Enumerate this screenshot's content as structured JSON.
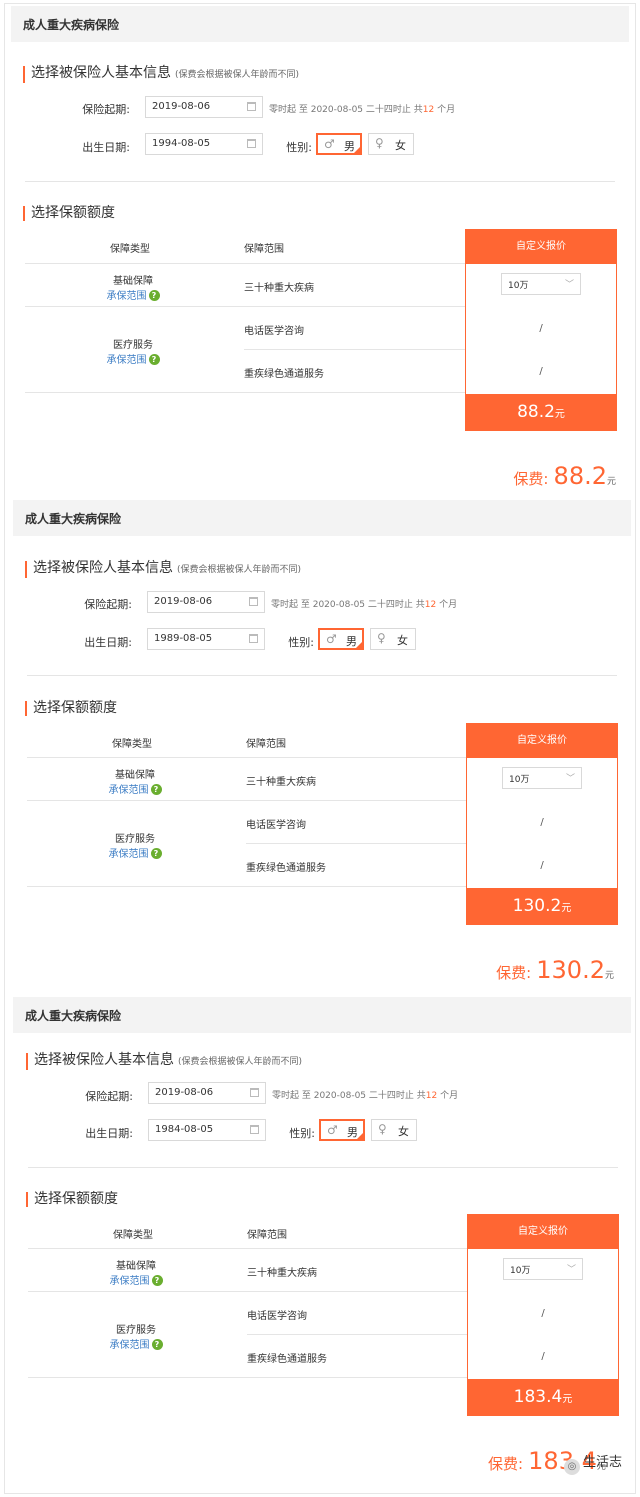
{
  "panels": [
    {
      "title": "成人重大疾病保险",
      "basic": {
        "title": "选择被保险人基本信息",
        "note": "(保费会根据被保人年龄而不同)"
      },
      "start": {
        "label": "保险起期:",
        "value": "2019-08-06"
      },
      "period": {
        "pre": "零时起 至 2020-08-05 二十四时止 共",
        "months": "12",
        "post": " 个月"
      },
      "birth": {
        "label": "出生日期:",
        "value": "1994-08-05"
      },
      "gender": {
        "label": "性别:",
        "male": "男",
        "female": "女",
        "selected": "male"
      },
      "coverage": {
        "title": "选择保额额度"
      },
      "table": {
        "col_type": "保障类型",
        "col_range": "保障范围",
        "col_custom": "自定义报价",
        "basic_type": "基础保障",
        "basic_link": "承保范围",
        "basic_range": "三十种重大疾病",
        "basic_amount": "10万",
        "medical_type": "医疗服务",
        "medical_link": "承保范围",
        "medical_range_1": "电话医学咨询",
        "medical_range_2": "重疾绿色通道服务",
        "slash": "/",
        "price": "88.2",
        "unit": "元"
      },
      "total": {
        "label": "保费:",
        "value": "88.2",
        "unit": "元"
      }
    },
    {
      "title": "成人重大疾病保险",
      "basic": {
        "title": "选择被保险人基本信息",
        "note": "(保费会根据被保人年龄而不同)"
      },
      "start": {
        "label": "保险起期:",
        "value": "2019-08-06"
      },
      "period": {
        "pre": "零时起 至 2020-08-05 二十四时止 共",
        "months": "12",
        "post": " 个月"
      },
      "birth": {
        "label": "出生日期:",
        "value": "1989-08-05"
      },
      "gender": {
        "label": "性别:",
        "male": "男",
        "female": "女",
        "selected": "male"
      },
      "coverage": {
        "title": "选择保额额度"
      },
      "table": {
        "col_type": "保障类型",
        "col_range": "保障范围",
        "col_custom": "自定义报价",
        "basic_type": "基础保障",
        "basic_link": "承保范围",
        "basic_range": "三十种重大疾病",
        "basic_amount": "10万",
        "medical_type": "医疗服务",
        "medical_link": "承保范围",
        "medical_range_1": "电话医学咨询",
        "medical_range_2": "重疾绿色通道服务",
        "slash": "/",
        "price": "130.2",
        "unit": "元"
      },
      "total": {
        "label": "保费:",
        "value": "130.2",
        "unit": "元"
      }
    },
    {
      "title": "成人重大疾病保险",
      "basic": {
        "title": "选择被保险人基本信息",
        "note": "(保费会根据被保人年龄而不同)"
      },
      "start": {
        "label": "保险起期:",
        "value": "2019-08-06"
      },
      "period": {
        "pre": "零时起 至 2020-08-05 二十四时止 共",
        "months": "12",
        "post": " 个月"
      },
      "birth": {
        "label": "出生日期:",
        "value": "1984-08-05"
      },
      "gender": {
        "label": "性别:",
        "male": "男",
        "female": "女",
        "selected": "male"
      },
      "coverage": {
        "title": "选择保额额度"
      },
      "table": {
        "col_type": "保障类型",
        "col_range": "保障范围",
        "col_custom": "自定义报价",
        "basic_type": "基础保障",
        "basic_link": "承保范围",
        "basic_range": "三十种重大疾病",
        "basic_amount": "10万",
        "medical_type": "医疗服务",
        "medical_link": "承保范围",
        "medical_range_1": "电话医学咨询",
        "medical_range_2": "重疾绿色通道服务",
        "slash": "/",
        "price": "183.4",
        "unit": "元"
      },
      "total": {
        "label": "保费:",
        "value": "183.4",
        "unit": "元"
      }
    }
  ],
  "watermark": "生活志",
  "colors": {
    "accent": "#ff6633",
    "link": "#3b7cc4",
    "help": "#6aae2f",
    "header_bg": "#f3f3f3"
  },
  "icons": {
    "calendar": "calendar-icon",
    "male": "male-icon",
    "female": "female-icon",
    "help": "help-icon",
    "dropdown": "chevron-down-icon"
  }
}
